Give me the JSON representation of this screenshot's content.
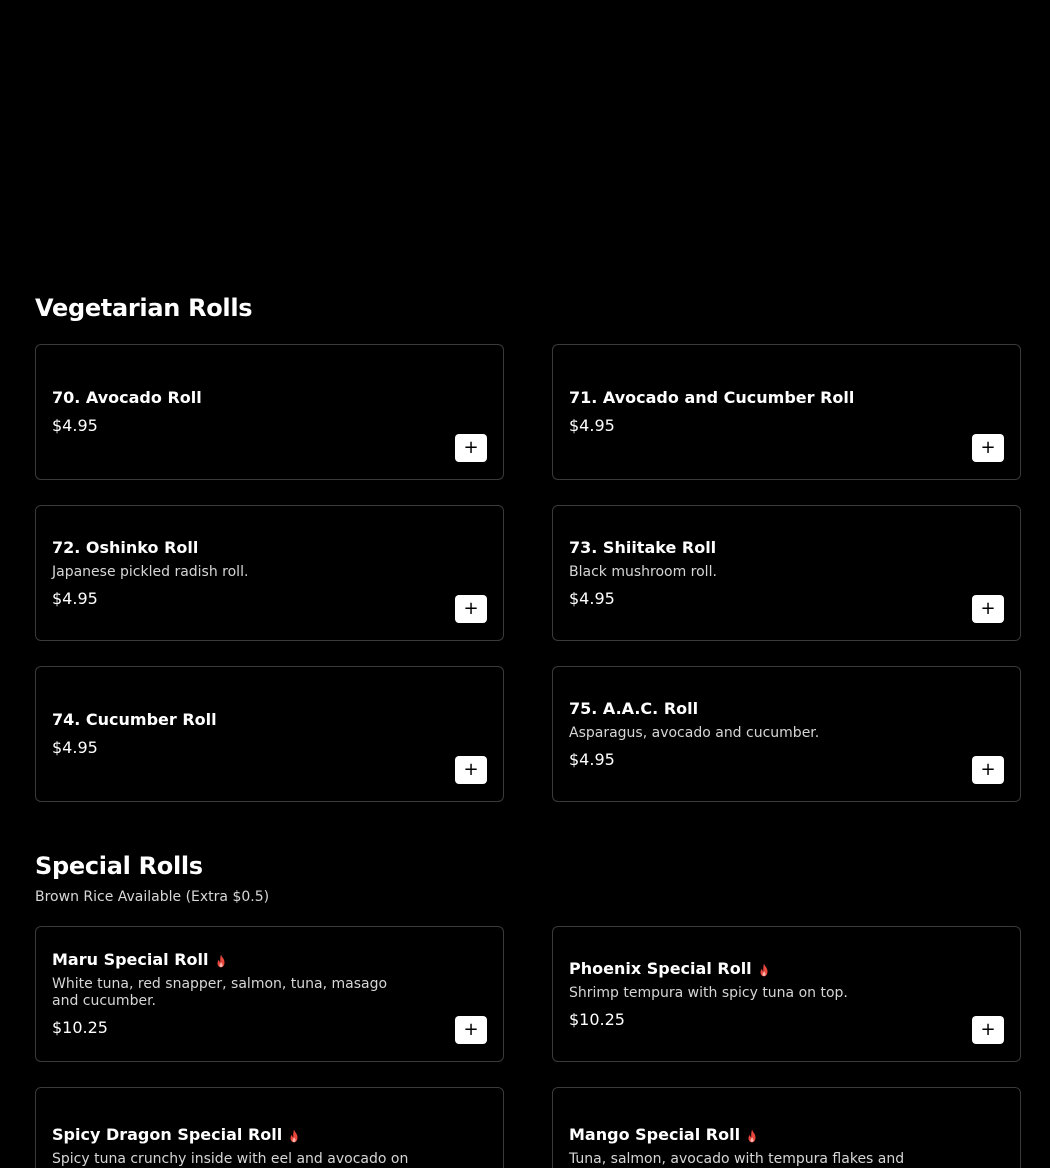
{
  "sections": [
    {
      "title": "Vegetarian Rolls",
      "subtitle": "",
      "items": [
        {
          "name": "70. Avocado Roll",
          "desc": "",
          "price": "$4.95",
          "spicy": false
        },
        {
          "name": "71. Avocado and Cucumber Roll",
          "desc": "",
          "price": "$4.95",
          "spicy": false
        },
        {
          "name": "72. Oshinko Roll",
          "desc": "Japanese pickled radish roll.",
          "price": "$4.95",
          "spicy": false
        },
        {
          "name": "73. Shiitake Roll",
          "desc": "Black mushroom roll.",
          "price": "$4.95",
          "spicy": false
        },
        {
          "name": "74. Cucumber Roll",
          "desc": "",
          "price": "$4.95",
          "spicy": false
        },
        {
          "name": "75. A.A.C. Roll",
          "desc": "Asparagus, avocado and cucumber.",
          "price": "$4.95",
          "spicy": false
        }
      ]
    },
    {
      "title": "Special Rolls",
      "subtitle": "Brown Rice Available (Extra $0.5)",
      "items": [
        {
          "name": "Maru Special Roll",
          "desc": "White tuna, red snapper, salmon, tuna, masago and cucumber.",
          "price": "$10.25",
          "spicy": true
        },
        {
          "name": "Phoenix Special Roll",
          "desc": "Shrimp tempura with spicy tuna on top.",
          "price": "$10.25",
          "spicy": true
        },
        {
          "name": "Spicy Dragon Special Roll",
          "desc": "Spicy tuna crunchy inside with eel and avocado on top.",
          "price": "",
          "spicy": true
        },
        {
          "name": "Mango Special Roll",
          "desc": "Tuna, salmon, avocado with tempura flakes and mango caviar on top.",
          "price": "",
          "spicy": true
        }
      ]
    }
  ],
  "add_button_label": "+",
  "colors": {
    "background": "#000000",
    "card_border": "#3a3a3a",
    "spicy": "#e8473c"
  },
  "icons": {
    "spicy": "flame-icon",
    "add": "plus-icon"
  }
}
